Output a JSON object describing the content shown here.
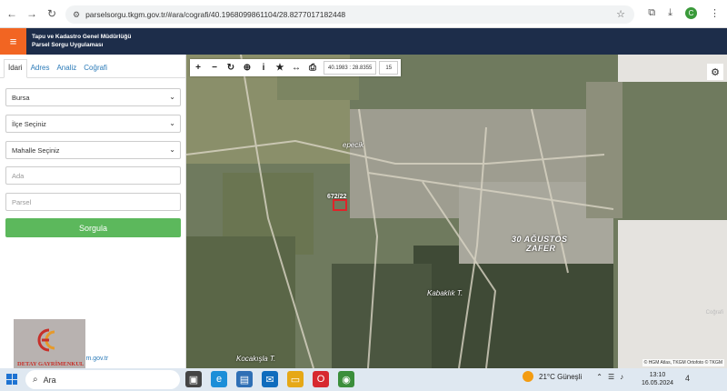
{
  "browser": {
    "url": "parselsorgu.tkgm.gov.tr/#ara/cografi/40.1968099861104/28.8277017182448",
    "back_icon": "back-arrow-icon",
    "forward_icon": "forward-arrow-icon",
    "reload_icon": "reload-icon",
    "profile_letter": "C"
  },
  "header": {
    "org": "Tapu ve Kadastro Genel Müdürlüğü",
    "app": "Parsel Sorgu Uygulaması",
    "accent": "#f26522",
    "bg": "#1d2d4a"
  },
  "sidebar": {
    "tabs": [
      "İdari",
      "Adres",
      "Analiz",
      "Coğrafi"
    ],
    "province": "Bursa",
    "district": "İlçe Seçiniz",
    "neighborhood": "Mahalle Seçiniz",
    "block_placeholder": "Ada",
    "parcel_placeholder": "Parsel",
    "query_label": "Sorgula",
    "query_color": "#5cb85c",
    "footer_email": "@tkgm.gov.tr"
  },
  "logo": {
    "text": "DETAY GAYRİMENKUL"
  },
  "map": {
    "coords": "40.1983 : 28.8355",
    "zoom": "15",
    "labels": {
      "epecik": "epecik",
      "zafer_1": "30 AĞUSTOS",
      "zafer_2": "ZAFER",
      "kabaklik": "Kabaklık T.",
      "kocakisla": "Kocakışla T."
    },
    "parcel_label": "672/22",
    "attribution": "© HGM Atlas, TKGM Ortofoto © TKGM",
    "ghost_coord": "Coğrafi"
  },
  "taskbar": {
    "search": "Ara",
    "weather": "21°C  Güneşli",
    "time": "13:10",
    "date": "16.05.2024",
    "notifications": "4"
  }
}
